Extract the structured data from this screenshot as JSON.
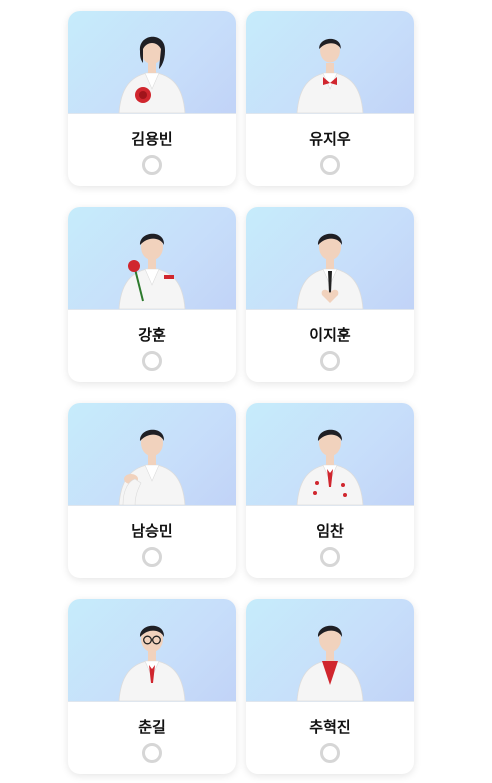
{
  "candidates": [
    {
      "name": "김용빈",
      "look": "rose-jacket",
      "hair": "long"
    },
    {
      "name": "유지우",
      "look": "child",
      "hair": "short"
    },
    {
      "name": "강훈",
      "look": "rose-hand",
      "hair": "short"
    },
    {
      "name": "이지훈",
      "look": "heart-hands",
      "hair": "short"
    },
    {
      "name": "남승민",
      "look": "pointing",
      "hair": "short"
    },
    {
      "name": "임찬",
      "look": "floral-suit",
      "hair": "short"
    },
    {
      "name": "춘길",
      "look": "glasses",
      "hair": "short"
    },
    {
      "name": "추혁진",
      "look": "red-shirt",
      "hair": "short"
    }
  ],
  "colors": {
    "photo_bg_start": "#c6ecfb",
    "photo_bg_end": "#c1d3f7",
    "suit": "#f5f5f5",
    "hair": "#1f1f24",
    "skin": "#f1d2bd",
    "accent_red": "#d0262e",
    "radio_border": "#d6d6d6"
  }
}
